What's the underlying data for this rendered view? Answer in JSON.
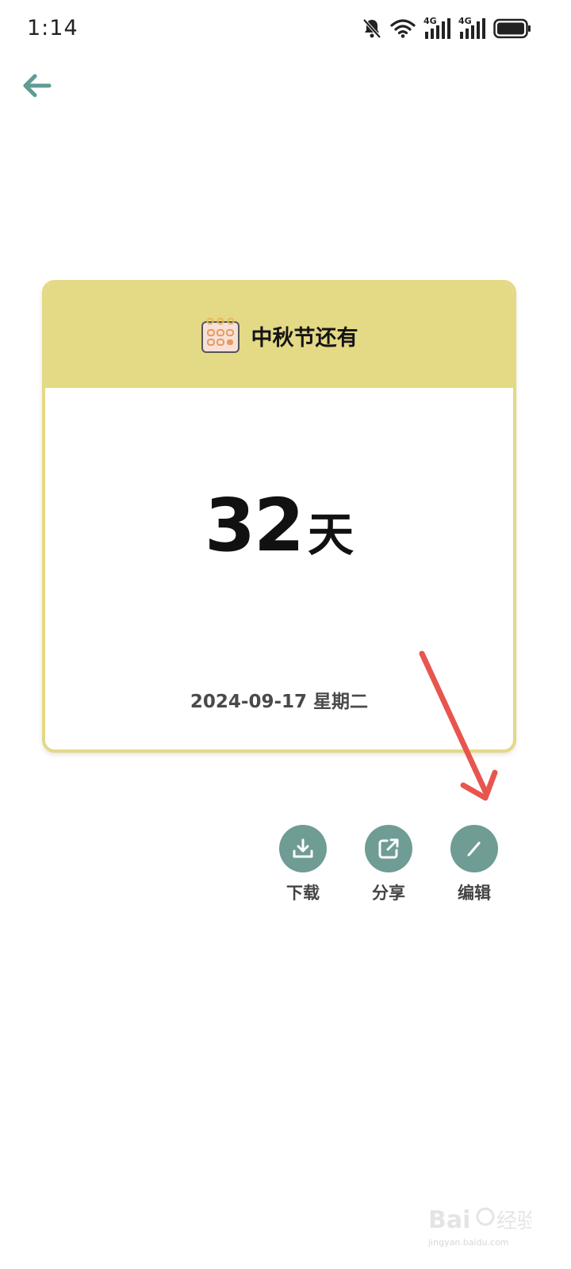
{
  "status_bar": {
    "time": "1:14",
    "icons": [
      "bell-off-icon",
      "wifi-icon",
      "signal-4g-icon",
      "signal-4g-icon",
      "battery-icon"
    ],
    "network_label_1": "4G",
    "network_label_2": "4G"
  },
  "nav": {
    "back_icon": "arrow-left-icon",
    "accent_color": "#5f9c93"
  },
  "card": {
    "title": "中秋节还有",
    "icon": "calendar-icon",
    "count_value": "32",
    "count_unit": "天",
    "date": "2024-09-17 星期二",
    "header_color": "#e4d985"
  },
  "actions": [
    {
      "label": "下载",
      "icon": "download-icon"
    },
    {
      "label": "分享",
      "icon": "share-icon"
    },
    {
      "label": "编辑",
      "icon": "pencil-icon"
    }
  ],
  "annotation": {
    "type": "red-arrow",
    "color": "#e8554f"
  },
  "watermark": {
    "text": "jingyan.baidu.com"
  }
}
